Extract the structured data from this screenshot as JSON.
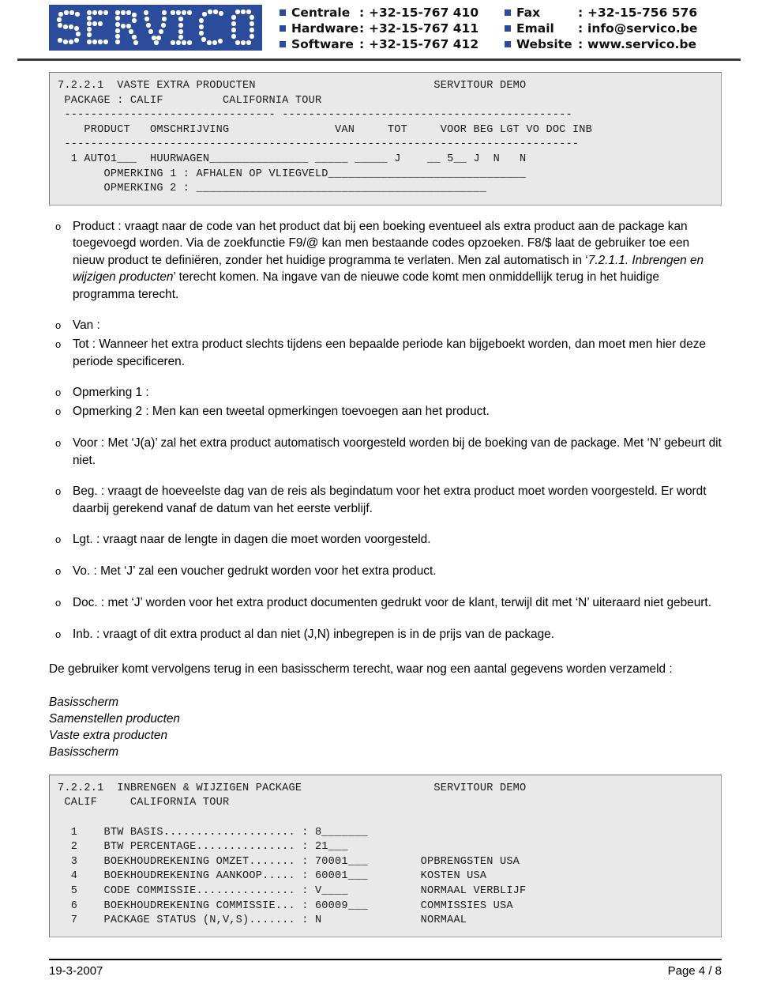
{
  "header": {
    "logo_text": "SERVICO",
    "logo_bg": "#2b4b9b",
    "contacts_left": [
      {
        "label": "Centrale",
        "sep": ":",
        "value": "+32-15-767 410"
      },
      {
        "label": "Hardware",
        "sep": ":",
        "value": "+32-15-767 411"
      },
      {
        "label": "Software",
        "sep": ":",
        "value": "+32-15-767 412"
      }
    ],
    "contacts_right": [
      {
        "label": "Fax",
        "sep": ":",
        "value": "+32-15-756 576"
      },
      {
        "label": "Email",
        "sep": ":",
        "value": "info@servico.be"
      },
      {
        "label": "Website",
        "sep": ":",
        "value": "www.servico.be"
      }
    ]
  },
  "terminal_top": {
    "lines": [
      "7.2.2.1  VASTE EXTRA PRODUCTEN                           SERVITOUR DEMO",
      " PACKAGE : CALIF         CALIFORNIA TOUR",
      " -------------------------------- --------------------------------------------",
      "    PRODUCT   OMSCHRIJVING                VAN     TOT     VOOR BEG LGT VO DOC INB",
      " ------------------------------------------------------------------------------",
      "  1 AUTO1___  HUURWAGEN_______________ _____ _____ J    __ 5__ J  N   N",
      "       OPMERKING 1 : AFHALEN OP VLIEGVELD______________________________",
      "       OPMERKING 2 : ____________________________________________"
    ]
  },
  "bullets": [
    {
      "marker": "o",
      "spaced": false,
      "runs": [
        {
          "t": "Product : vraagt naar de code van het product dat bij een boeking eventueel als extra product aan de package kan toegevoegd worden.  Via de zoekfunctie F9/@ kan men bestaande codes opzoeken.  F8/$ laat de gebruiker toe een nieuw product te definiëren, zonder het huidige programma te verlaten.  Men zal automatisch in ‘",
          "i": false
        },
        {
          "t": "7.2.1.1. Inbrengen en wijzigen producten",
          "i": true
        },
        {
          "t": "’ terecht komen.  Na ingave van de nieuwe code komt men onmiddellijk terug in het huidige programma terecht.",
          "i": false
        }
      ]
    },
    {
      "marker": "o",
      "spaced": true,
      "runs": [
        {
          "t": "Van :",
          "i": false
        }
      ]
    },
    {
      "marker": "o",
      "spaced": false,
      "runs": [
        {
          "t": "Tot : Wanneer het extra product slechts tijdens een bepaalde periode kan bijgeboekt worden, dan moet men hier deze periode specificeren.",
          "i": false
        }
      ]
    },
    {
      "marker": "o",
      "spaced": true,
      "runs": [
        {
          "t": "Opmerking 1 :",
          "i": false
        }
      ]
    },
    {
      "marker": "o",
      "spaced": false,
      "runs": [
        {
          "t": "Opmerking 2 : Men kan een tweetal opmerkingen toevoegen aan het product.",
          "i": false
        }
      ]
    },
    {
      "marker": "o",
      "spaced": true,
      "runs": [
        {
          "t": "Voor : Met ‘J(a)’ zal het extra product automatisch voorgesteld worden bij de boeking van de package. Met ‘N’ gebeurt dit niet.",
          "i": false
        }
      ]
    },
    {
      "marker": "o",
      "spaced": true,
      "runs": [
        {
          "t": "Beg. : vraagt de hoeveelste dag van de reis als begindatum voor het extra product moet worden voorgesteld. Er wordt daarbij gerekend vanaf de datum van het eerste verblijf.",
          "i": false
        }
      ]
    },
    {
      "marker": "o",
      "spaced": true,
      "runs": [
        {
          "t": "Lgt. : vraagt naar de lengte in dagen die moet worden voorgesteld.",
          "i": false
        }
      ]
    },
    {
      "marker": "o",
      "spaced": true,
      "runs": [
        {
          "t": "Vo. : Met ‘J’ zal een voucher gedrukt worden voor het extra product.",
          "i": false
        }
      ]
    },
    {
      "marker": "o",
      "spaced": true,
      "runs": [
        {
          "t": "Doc. : met ‘J’ worden voor het extra product documenten gedrukt voor de klant, terwijl dit met ‘N’ uiteraard niet gebeurt.",
          "i": false
        }
      ]
    },
    {
      "marker": "o",
      "spaced": true,
      "runs": [
        {
          "t": "Inb. : vraagt of dit extra product al dan niet (J,N) inbegrepen is in de prijs van de package.",
          "i": false
        }
      ]
    }
  ],
  "paragraph": "De gebruiker komt vervolgens terug in een basisscherm terecht, waar nog een aantal gegevens worden verzameld :",
  "italic_list": [
    "Basisscherm",
    "Samenstellen producten",
    "Vaste extra producten",
    "Basisscherm"
  ],
  "terminal_bottom": {
    "lines": [
      "7.2.2.1  INBRENGEN & WIJZIGEN PACKAGE                    SERVITOUR DEMO",
      " CALIF     CALIFORNIA TOUR",
      "",
      "  1    BTW BASIS.................... : 8_______",
      "  2    BTW PERCENTAGE............... : 21___",
      "  3    BOEKHOUDREKENING OMZET....... : 70001___        OPBRENGSTEN USA",
      "  4    BOEKHOUDREKENING AANKOOP..... : 60001___        KOSTEN USA",
      "  5    CODE COMMISSIE............... : V____           NORMAAL VERBLIJF",
      "  6    BOEKHOUDREKENING COMMISSIE... : 60009___        COMMISSIES USA",
      "  7    PACKAGE STATUS (N,V,S)....... : N               NORMAAL"
    ]
  },
  "footer": {
    "date": "19-3-2007",
    "page": "Page 4 / 8"
  }
}
